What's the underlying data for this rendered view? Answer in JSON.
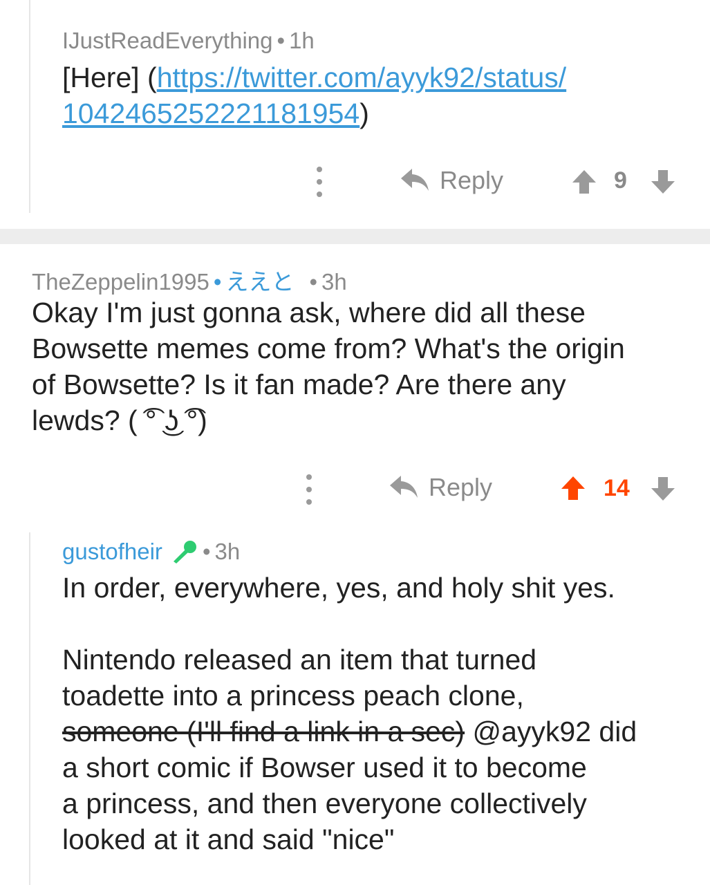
{
  "comments": [
    {
      "author": "IJustReadEverything",
      "age": "1h",
      "body_prefix": "[Here] (",
      "link_line1": "https://twitter.com/ayyk92/status/",
      "link_line2": "1042465252221181954",
      "body_suffix": ")",
      "reply_label": "Reply",
      "score": "9",
      "upvoted": false
    },
    {
      "author": "TheZeppelin1995",
      "flair": "ええと",
      "age": "3h",
      "body_lines": [
        "Okay I'm just gonna ask, where did all these",
        "Bowsette memes come from? What's the origin",
        "of Bowsette? Is it fan made? Are there any",
        "lewds? ( ͡° ͜ʖ ͡°)"
      ],
      "reply_label": "Reply",
      "score": "14",
      "upvoted": true
    },
    {
      "author": "gustofheir",
      "age": "3h",
      "para1": "In order, everywhere, yes, and holy shit yes.",
      "para2_line1": "Nintendo released an item that turned",
      "para2_line2": "toadette into a princess peach clone,",
      "para2_struck": "someone (I'll find a link in a sec)",
      "para2_after_strike": " @ayyk92 did",
      "para2_line4": "a short comic if Bowser used it to become",
      "para2_line5": "a princess, and then everyone collectively",
      "para2_line6": "looked at it and said \"nice\""
    }
  ],
  "colors": {
    "link": "#3b9ad9",
    "upvote": "#ff4500",
    "muted": "#8a8a8a"
  },
  "icons": [
    "more-vertical-icon",
    "reply-arrow-icon",
    "upvote-arrow-icon",
    "downvote-arrow-icon",
    "microphone-flair-icon"
  ]
}
